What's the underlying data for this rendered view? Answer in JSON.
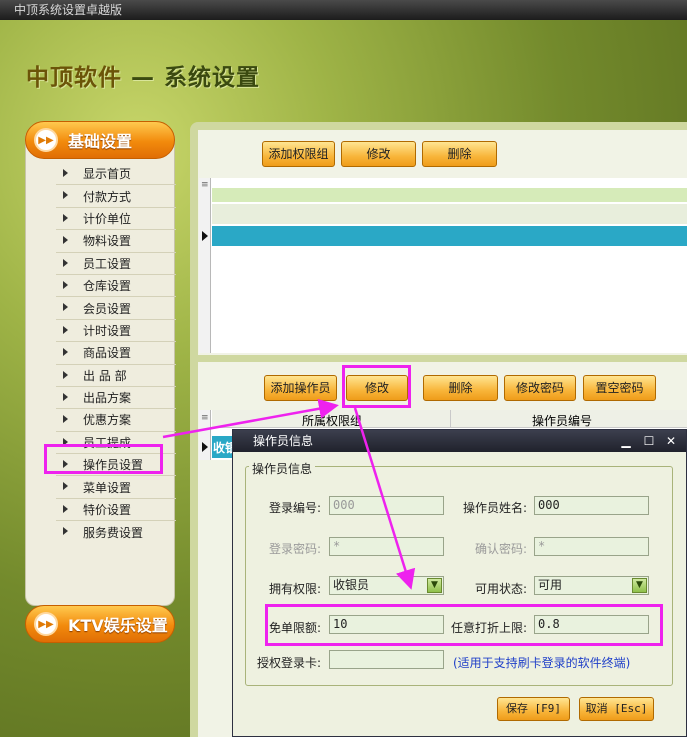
{
  "window": {
    "title": "中顶系统设置卓越版"
  },
  "header": {
    "brand": "中顶软件",
    "title": " — 系统设置"
  },
  "sidebar": {
    "category1": "基础设置",
    "items": [
      "显示首页",
      "付款方式",
      "计价单位",
      "物料设置",
      "员工设置",
      "仓库设置",
      "会员设置",
      "计时设置",
      "商品设置",
      "出 品 部",
      "出品方案",
      "优惠方案",
      "员工提成",
      "操作员设置",
      "菜单设置",
      "特价设置",
      "服务费设置"
    ],
    "category2": "KTV娱乐设置"
  },
  "top_toolbar": {
    "add_group": "添加权限组",
    "edit": "修改",
    "delete": "删除"
  },
  "bottom_toolbar": {
    "add_operator": "添加操作员",
    "edit": "修改",
    "delete": "删除",
    "change_password": "修改密码",
    "clear_password": "置空密码"
  },
  "operator_grid": {
    "columns": [
      "所属权限组",
      "操作员编号"
    ],
    "row_fragment": "收银"
  },
  "dialog": {
    "title": "操作员信息",
    "group_label": "操作员信息",
    "login_id_label": "登录编号:",
    "login_id": "000",
    "name_label": "操作员姓名:",
    "name": "000",
    "password_label": "登录密码:",
    "password": "*",
    "confirm_label": "确认密码:",
    "confirm": "*",
    "role_label": "拥有权限:",
    "role": "收银员",
    "status_label": "可用状态:",
    "status": "可用",
    "free_limit_label": "免单限额:",
    "free_limit": "10",
    "discount_label": "任意打折上限:",
    "discount": "0.8",
    "card_label": "授权登录卡:",
    "card": "",
    "card_hint": "(适用于支持刷卡登录的软件终端)",
    "save": "保存 [F9]",
    "cancel": "取消 [Esc]"
  },
  "icons": [
    "play-icon",
    "arrow-icon",
    "minimize-icon",
    "maximize-icon",
    "close-icon"
  ],
  "colors": {
    "accent": "#f28a0c",
    "highlight": "#ee22ee",
    "selected_row": "#2aa8c6"
  }
}
